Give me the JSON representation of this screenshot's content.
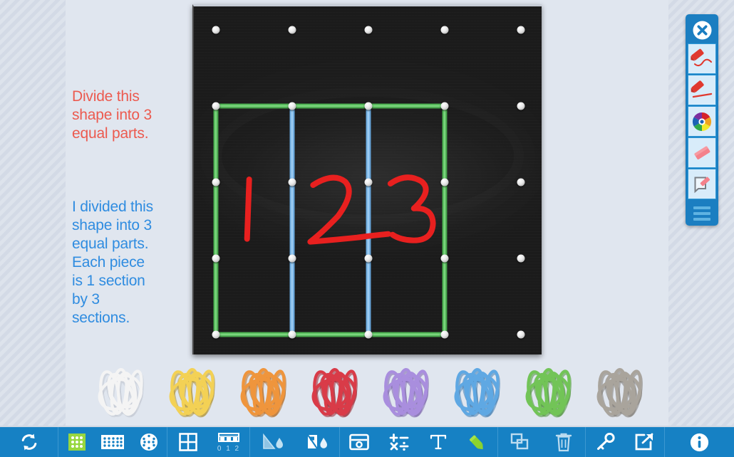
{
  "app": {
    "name": "Geoboard",
    "background_color": "#e0e6ef",
    "accent_color": "#1681c4"
  },
  "lesson": {
    "question_text": "Divide this\nshape into 3\nequal parts.",
    "question_color": "#ec5a4f",
    "answer_text": "I divided this\nshape into 3\nequal parts.\nEach piece\nis 1 section\nby 3\nsections.",
    "answer_color": "#2f8ce0"
  },
  "geoboard": {
    "rows": 5,
    "cols": 5,
    "board_color": "#242424",
    "peg_color": "#e8e8e8",
    "pegs": [
      {
        "row": 0,
        "col": 0
      },
      {
        "row": 0,
        "col": 1
      },
      {
        "row": 0,
        "col": 2
      },
      {
        "row": 0,
        "col": 3
      },
      {
        "row": 0,
        "col": 4
      },
      {
        "row": 1,
        "col": 0
      },
      {
        "row": 1,
        "col": 1
      },
      {
        "row": 1,
        "col": 2
      },
      {
        "row": 1,
        "col": 3
      },
      {
        "row": 1,
        "col": 4
      },
      {
        "row": 2,
        "col": 0
      },
      {
        "row": 2,
        "col": 1
      },
      {
        "row": 2,
        "col": 2
      },
      {
        "row": 2,
        "col": 3
      },
      {
        "row": 2,
        "col": 4
      },
      {
        "row": 3,
        "col": 0
      },
      {
        "row": 3,
        "col": 1
      },
      {
        "row": 3,
        "col": 2
      },
      {
        "row": 3,
        "col": 3
      },
      {
        "row": 3,
        "col": 4
      },
      {
        "row": 4,
        "col": 0
      },
      {
        "row": 4,
        "col": 1
      },
      {
        "row": 4,
        "col": 2
      },
      {
        "row": 4,
        "col": 3
      },
      {
        "row": 4,
        "col": 4
      }
    ],
    "bands": [
      {
        "color_name": "green",
        "color": "#62c766",
        "orientation": "h",
        "row": 1,
        "col_start": 0,
        "col_end": 3
      },
      {
        "color_name": "green",
        "color": "#62c766",
        "orientation": "h",
        "row": 4,
        "col_start": 0,
        "col_end": 3
      },
      {
        "color_name": "green",
        "color": "#62c766",
        "orientation": "v",
        "col": 0,
        "row_start": 1,
        "row_end": 4
      },
      {
        "color_name": "green",
        "color": "#62c766",
        "orientation": "v",
        "col": 3,
        "row_start": 1,
        "row_end": 4
      },
      {
        "color_name": "blue",
        "color": "#84bdea",
        "orientation": "v",
        "col": 1,
        "row_start": 1,
        "row_end": 4
      },
      {
        "color_name": "blue",
        "color": "#84bdea",
        "orientation": "v",
        "col": 2,
        "row_start": 1,
        "row_end": 4
      }
    ],
    "annotations": [
      {
        "label": "1",
        "color": "#e8201f"
      },
      {
        "label": "2",
        "color": "#e8201f"
      },
      {
        "label": "3",
        "color": "#e8201f"
      }
    ]
  },
  "band_tray": {
    "bundles": [
      {
        "name": "white-rubber-bands",
        "color": "#f4f4f4",
        "shadow": "#c2c8d2"
      },
      {
        "name": "yellow-rubber-bands",
        "color": "#f3d155",
        "shadow": "#b09433"
      },
      {
        "name": "orange-rubber-bands",
        "color": "#ef953c",
        "shadow": "#b56a21"
      },
      {
        "name": "red-rubber-bands",
        "color": "#d93b48",
        "shadow": "#9d2430"
      },
      {
        "name": "purple-rubber-bands",
        "color": "#a98ede",
        "shadow": "#7a62ab"
      },
      {
        "name": "blue-rubber-bands",
        "color": "#5fa8e3",
        "shadow": "#3f7cb0"
      },
      {
        "name": "green-rubber-bands",
        "color": "#72c457",
        "shadow": "#4b9137"
      },
      {
        "name": "gray-rubber-bands",
        "color": "#a9a49c",
        "shadow": "#7d7871"
      }
    ]
  },
  "right_toolbar": {
    "close_label": "Close",
    "tools": [
      {
        "name": "pen-freehand-tool",
        "label": "Pen",
        "selected": false
      },
      {
        "name": "pen-line-tool",
        "label": "Straight Line",
        "selected": false
      },
      {
        "name": "color-picker-tool",
        "label": "Color",
        "selected": false
      },
      {
        "name": "eraser-tool",
        "label": "Eraser",
        "selected": false
      },
      {
        "name": "note-tool",
        "label": "Note",
        "selected": false
      }
    ],
    "menu_label": "Menu"
  },
  "bottom_toolbar": {
    "groups": [
      {
        "name": "reset-group",
        "buttons": [
          {
            "name": "reset-button",
            "icon": "refresh-icon",
            "label": "Reset",
            "selected": false
          }
        ]
      },
      {
        "name": "board-type-group",
        "buttons": [
          {
            "name": "board-square-small-button",
            "icon": "grid-small-icon",
            "label": "5 x 5 Board",
            "selected": true
          },
          {
            "name": "board-rect-button",
            "icon": "grid-wide-icon",
            "label": "Rectangular Board",
            "selected": false
          },
          {
            "name": "board-circle-button",
            "icon": "circle-grid-icon",
            "label": "Circular Board",
            "selected": false
          }
        ]
      },
      {
        "name": "overlay-group",
        "buttons": [
          {
            "name": "grid-overlay-button",
            "icon": "grid-overlay-icon",
            "label": "Grid",
            "selected": false
          },
          {
            "name": "number-line-button",
            "icon": "number-line-icon",
            "label": "0 1 2",
            "selected": false
          }
        ]
      },
      {
        "name": "fill-group",
        "buttons": [
          {
            "name": "fill-shape-button",
            "icon": "fill-triangle-icon",
            "label": "Fill Shape",
            "selected": false
          },
          {
            "name": "fill-all-button",
            "icon": "fill-all-icon",
            "label": "Fill All",
            "selected": false
          }
        ]
      },
      {
        "name": "annotate-group",
        "buttons": [
          {
            "name": "camera-button",
            "icon": "camera-icon",
            "label": "Camera",
            "selected": false
          },
          {
            "name": "math-operators-button",
            "icon": "math-operators-icon",
            "label": "Math",
            "selected": false
          },
          {
            "name": "text-tool-button",
            "icon": "text-t-icon",
            "label": "Text",
            "selected": false
          },
          {
            "name": "draw-tool-button",
            "icon": "pencil-icon",
            "label": "Draw",
            "selected": true
          }
        ]
      },
      {
        "name": "edit-group",
        "buttons": [
          {
            "name": "duplicate-button",
            "icon": "duplicate-icon",
            "label": "Duplicate",
            "selected": false
          },
          {
            "name": "delete-button",
            "icon": "trash-icon",
            "label": "Delete",
            "selected": false
          }
        ]
      },
      {
        "name": "share-group",
        "buttons": [
          {
            "name": "key-button",
            "icon": "key-icon",
            "label": "Key",
            "selected": false
          },
          {
            "name": "share-button",
            "icon": "share-icon",
            "label": "Share",
            "selected": false
          }
        ]
      },
      {
        "name": "info-group",
        "buttons": [
          {
            "name": "info-button",
            "icon": "info-icon",
            "label": "Info",
            "selected": false
          }
        ]
      }
    ],
    "number_line_label": "0 1 2"
  }
}
